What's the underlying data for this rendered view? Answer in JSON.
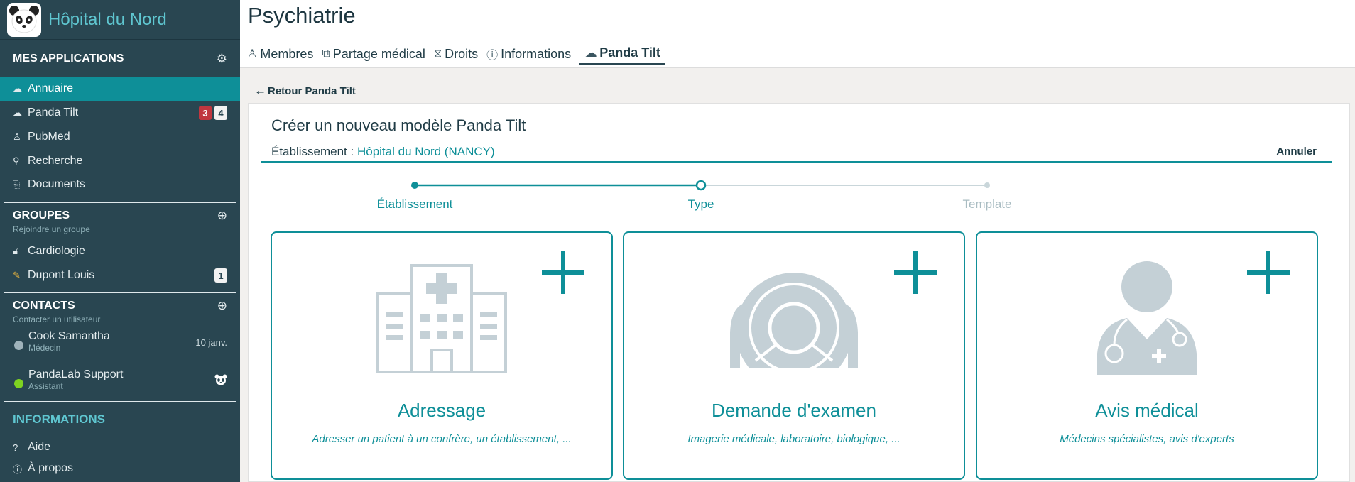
{
  "hospital": {
    "name": "Hôpital du Nord"
  },
  "sidebar": {
    "apps_header": "MES APPLICATIONS",
    "apps": [
      {
        "label": "Annuaire",
        "icon": "cloud-icon"
      },
      {
        "label": "Panda Tilt",
        "icon": "cloud-icon",
        "badge_red": "3",
        "badge_white": "4"
      },
      {
        "label": "PubMed",
        "icon": "user-icon"
      },
      {
        "label": "Recherche",
        "icon": "search-icon"
      },
      {
        "label": "Documents",
        "icon": "paperclip-icon"
      }
    ],
    "groups_header": "GROUPES",
    "groups_sub": "Rejoindre un groupe",
    "groups": [
      {
        "label": "Cardiologie",
        "icon": "lock-icon"
      },
      {
        "label": "Dupont Louis",
        "icon": "pencil-icon",
        "badge_white": "1"
      }
    ],
    "contacts_header": "CONTACTS",
    "contacts_sub": "Contacter un utilisateur",
    "contacts": [
      {
        "name": "Cook Samantha",
        "role": "Médecin",
        "meta": "10 janv.",
        "status_color": "#9fb3bb"
      },
      {
        "name": "PandaLab Support",
        "role": "Assistant",
        "status_color": "#7ed321"
      }
    ],
    "info_header": "INFORMATIONS",
    "info": [
      {
        "label": "Aide",
        "icon": "question-icon"
      },
      {
        "label": "À propos",
        "icon": "info-icon"
      }
    ]
  },
  "page": {
    "title": "Psychiatrie",
    "tabs": [
      {
        "label": "Membres"
      },
      {
        "label": "Partage médical"
      },
      {
        "label": "Droits"
      },
      {
        "label": "Informations"
      },
      {
        "label": "Panda Tilt"
      }
    ],
    "back_label": "Retour Panda Tilt"
  },
  "wizard": {
    "title": "Créer un nouveau modèle Panda Tilt",
    "etab_label": "Établissement :",
    "etab_value": "Hôpital du Nord (NANCY)",
    "cancel": "Annuler",
    "steps": [
      {
        "label": "Établissement",
        "state": "done"
      },
      {
        "label": "Type",
        "state": "current"
      },
      {
        "label": "Template",
        "state": "todo"
      }
    ],
    "cards": [
      {
        "title": "Adressage",
        "desc": "Adresser un patient à un confrère, un établissement, ..."
      },
      {
        "title": "Demande d'examen",
        "desc": "Imagerie médicale, laboratoire, biologique, ..."
      },
      {
        "title": "Avis médical",
        "desc": "Médecins spécialistes, avis d'experts"
      }
    ]
  },
  "colors": {
    "sidebar_bg": "#294651",
    "accent": "#0e8f98",
    "brand_text": "#5fc6d0",
    "badge_red": "#c0363f"
  }
}
